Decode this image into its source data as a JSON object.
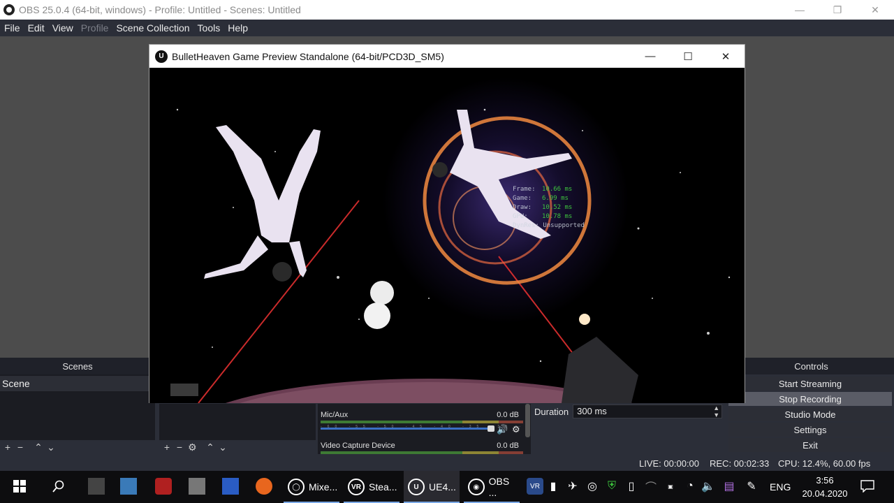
{
  "obs": {
    "title": "OBS 25.0.4 (64-bit, windows) - Profile: Untitled - Scenes: Untitled",
    "window_buttons": {
      "minimize": "—",
      "restore": "❐",
      "close": "✕"
    },
    "menu": [
      "File",
      "Edit",
      "View",
      "Profile",
      "Scene Collection",
      "Tools",
      "Help"
    ],
    "menu_disabled": "Profile"
  },
  "game_window": {
    "title": "BulletHeaven Game Preview Standalone (64-bit/PCD3D_SM5)",
    "logo": "U",
    "buttons": {
      "minimize": "—",
      "maximize": "☐",
      "close": "✕"
    },
    "stats": [
      {
        "key": "Frame:",
        "value": "10.66 ms"
      },
      {
        "key": "Game:",
        "value": "6.99 ms"
      },
      {
        "key": "Draw:",
        "value": "10.52 ms"
      },
      {
        "key": "GPU:",
        "value": "10.78 ms"
      }
    ],
    "stats_footer": "DynRes: Unsupported"
  },
  "docks": {
    "scenes": {
      "header": "Scenes",
      "items": [
        "Scene"
      ],
      "toolbar": [
        "+",
        "−",
        "⌃",
        "⌄"
      ]
    },
    "sources": {
      "toolbar": [
        "+",
        "−",
        "⚙",
        "⌃",
        "⌄"
      ]
    },
    "controls": {
      "header": "Controls",
      "buttons": [
        "Start Streaming",
        "Stop Recording",
        "Studio Mode",
        "Settings",
        "Exit"
      ],
      "active": "Stop Recording"
    }
  },
  "mixer": {
    "channels": [
      {
        "name": "Mic/Aux",
        "db": "0.0 dB"
      },
      {
        "name": "Video Capture Device",
        "db": "0.0 dB"
      }
    ],
    "ticks": "-60 -55 -50 -45 -40 -35 -30 -25 -20 -15 -10 -5 0",
    "volume_icon": "🔊",
    "gear_icon": "⚙"
  },
  "transitions": {
    "duration_label": "Duration",
    "duration_value": "300 ms"
  },
  "status": {
    "live": "LIVE: 00:00:00",
    "rec": "REC: 00:02:33",
    "cpu": "CPU: 12.4%, 60.00 fps"
  },
  "taskbar": {
    "apps": [
      {
        "label": "Mixe...",
        "logo": "◯"
      },
      {
        "label": "Stea...",
        "logo": "VR"
      },
      {
        "label": "UE4...",
        "logo": "U"
      },
      {
        "label": "OBS ...",
        "logo": "◉"
      }
    ],
    "tray_lang": "ENG",
    "time": "3:56",
    "date": "20.04.2020"
  }
}
